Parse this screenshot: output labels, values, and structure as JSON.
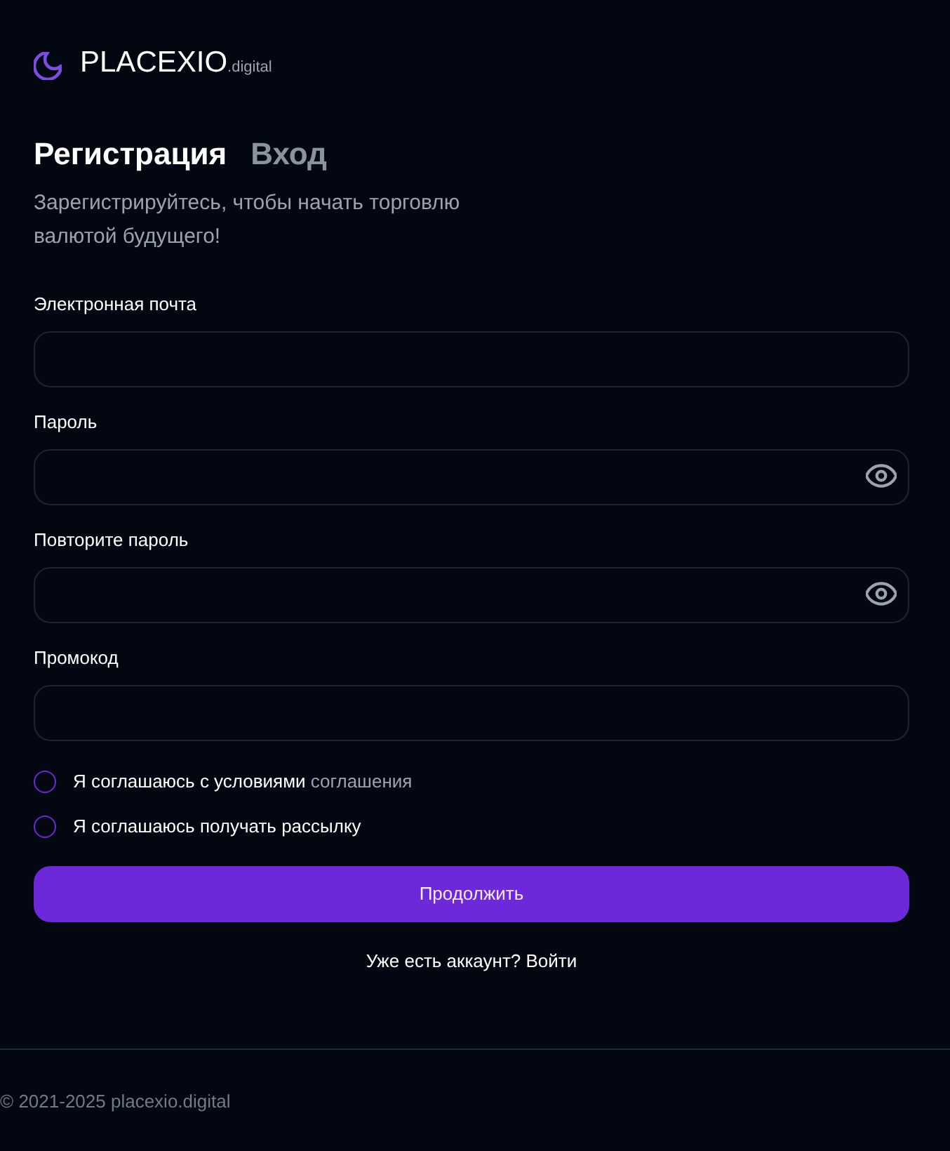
{
  "logo": {
    "name": "PLACEXIO",
    "suffix": ".digital"
  },
  "tabs": [
    {
      "label": "Регистрация",
      "selected": true
    },
    {
      "label": "Вход",
      "selected": false
    }
  ],
  "subtitle": "Зарегистрируйтесь, чтобы начать торговлю валютой будущего!",
  "fields": [
    {
      "label": "Электронная почта",
      "kind": "text"
    },
    {
      "label": "Пароль",
      "kind": "password"
    },
    {
      "label": "Повторите пароль",
      "kind": "password"
    },
    {
      "label": "Промокод",
      "kind": "text"
    }
  ],
  "agreements": [
    {
      "text": "Я соглашаюсь с условиями",
      "link": "соглашения",
      "checked": false
    },
    {
      "text": "Я соглашаюсь получать рассылку",
      "checked": false
    }
  ],
  "submit_button": "Продолжить",
  "login_prompt": "Уже есть аккаунт? Войти",
  "footer": "© 2021-2025 placexio.digital"
}
